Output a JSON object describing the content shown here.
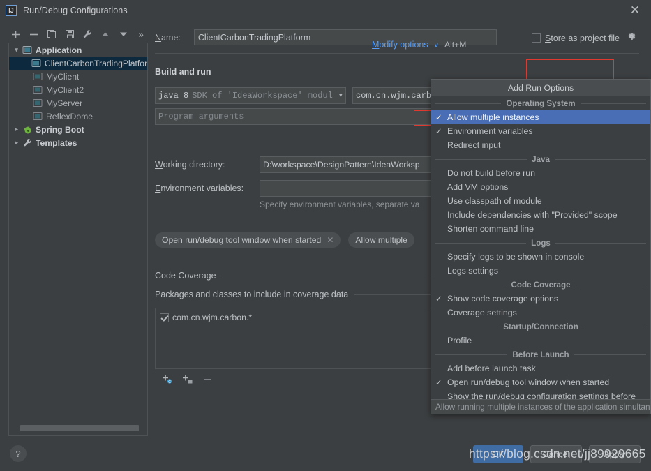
{
  "window": {
    "title": "Run/Debug Configurations",
    "logo_text": "IJ",
    "close_label": "✕"
  },
  "sidebar": {
    "toolbar": [
      {
        "name": "add-configuration-button",
        "glyph": "+"
      },
      {
        "name": "remove-configuration-button",
        "glyph": "−"
      },
      {
        "name": "copy-configuration-button",
        "glyph": "copy"
      },
      {
        "name": "save-configuration-button",
        "glyph": "save"
      },
      {
        "name": "edit-templates-button",
        "glyph": "wrench"
      },
      {
        "name": "move-up-button",
        "glyph": "up"
      },
      {
        "name": "move-down-button",
        "glyph": "down"
      },
      {
        "name": "more-options-button",
        "glyph": "»"
      }
    ],
    "tree": [
      {
        "label": "Application",
        "level": 0,
        "type": "group",
        "expanded": true,
        "icon": "application-icon",
        "selected": false
      },
      {
        "label": "ClientCarbonTradingPlatform",
        "level": 1,
        "type": "item",
        "icon": "application-icon",
        "selected": true
      },
      {
        "label": "MyClient",
        "level": 1,
        "type": "item",
        "icon": "application-icon",
        "selected": false
      },
      {
        "label": "MyClient2",
        "level": 1,
        "type": "item",
        "icon": "application-icon",
        "selected": false
      },
      {
        "label": "MyServer",
        "level": 1,
        "type": "item",
        "icon": "application-icon",
        "selected": false
      },
      {
        "label": "ReflexDome",
        "level": 1,
        "type": "item",
        "icon": "application-icon",
        "selected": false
      },
      {
        "label": "Spring Boot",
        "level": 0,
        "type": "group",
        "expanded": false,
        "icon": "spring-boot-icon",
        "selected": false
      },
      {
        "label": "Templates",
        "level": 0,
        "type": "group",
        "expanded": false,
        "icon": "wrench-icon",
        "selected": false
      }
    ],
    "help_label": "?"
  },
  "form": {
    "name_label": "Name:",
    "name_label_mnemonic": "N",
    "name_value": "ClientCarbonTradingPlatform",
    "store_as_project_file_label": "Store as project file",
    "store_as_project_file_mnemonic": "S",
    "store_as_project_file_checked": false,
    "build_and_run_title": "Build and run",
    "jre_value_bold": "java 8",
    "jre_value_rest": "SDK of 'IdeaWorkspace' modul",
    "main_class_value": "com.cn.wjm.carb",
    "program_arguments_placeholder": "Program arguments",
    "working_directory_label": "Working directory:",
    "working_directory_mnemonic": "W",
    "working_directory_value": "D:\\workspace\\DesignPattern\\IdeaWorksp",
    "environment_variables_label": "Environment variables:",
    "environment_variables_mnemonic": "E",
    "environment_variables_value": "",
    "environment_variables_hint": "Specify environment variables, separate va",
    "chips": [
      {
        "label": "Open run/debug tool window when started",
        "closable": true
      },
      {
        "label": "Allow multiple",
        "closable": false
      }
    ],
    "code_coverage_title": "Code Coverage",
    "packages_group_title": "Packages and classes to include in coverage data",
    "coverage_entries": [
      {
        "label": "com.cn.wjm.carbon.*",
        "checked": true
      }
    ],
    "coverage_toolbar": [
      {
        "name": "add-class-button",
        "glyph": "+c"
      },
      {
        "name": "add-package-button",
        "glyph": "+p"
      },
      {
        "name": "remove-entry-button",
        "glyph": "-"
      }
    ]
  },
  "modify_options": {
    "link_label": "Modify options",
    "link_mnemonic": "M",
    "caret": "∨",
    "shortcut": "Alt+M",
    "menu_header": "Add Run Options",
    "hint": "Allow running multiple instances of the application simultaneou",
    "groups": [
      {
        "title": "Operating System",
        "items": [
          {
            "label": "Allow multiple instances",
            "checked": true,
            "highlighted": true
          },
          {
            "label": "Environment variables",
            "checked": true,
            "highlighted": false
          },
          {
            "label": "Redirect input",
            "checked": false,
            "highlighted": false
          }
        ]
      },
      {
        "title": "Java",
        "items": [
          {
            "label": "Do not build before run",
            "checked": false,
            "highlighted": false
          },
          {
            "label": "Add VM options",
            "checked": false,
            "highlighted": false
          },
          {
            "label": "Use classpath of module",
            "checked": false,
            "highlighted": false
          },
          {
            "label": "Include dependencies with \"Provided\" scope",
            "checked": false,
            "highlighted": false
          },
          {
            "label": "Shorten command line",
            "checked": false,
            "highlighted": false
          }
        ]
      },
      {
        "title": "Logs",
        "items": [
          {
            "label": "Specify logs to be shown in console",
            "checked": false,
            "highlighted": false
          },
          {
            "label": "Logs settings",
            "checked": false,
            "highlighted": false
          }
        ]
      },
      {
        "title": "Code Coverage",
        "items": [
          {
            "label": "Show code coverage options",
            "checked": true,
            "highlighted": false
          },
          {
            "label": "Coverage settings",
            "checked": false,
            "highlighted": false
          }
        ]
      },
      {
        "title": "Startup/Connection",
        "items": [
          {
            "label": "Profile",
            "checked": false,
            "highlighted": false
          }
        ]
      },
      {
        "title": "Before Launch",
        "items": [
          {
            "label": "Add before launch task",
            "checked": false,
            "highlighted": false
          },
          {
            "label": "Open run/debug tool window when started",
            "checked": true,
            "highlighted": false
          },
          {
            "label": "Show the run/debug configuration settings before",
            "checked": false,
            "highlighted": false
          }
        ]
      }
    ]
  },
  "buttons": {
    "ok": "OK",
    "cancel": "Cancel",
    "apply": "Apply"
  },
  "watermark": "https://blog.csdn.net/jj89929665",
  "colors": {
    "dialog_bg": "#3c3f41",
    "accent_link": "#589df6",
    "menu_highlight": "#4a6eb5",
    "tree_selected": "#0d293e",
    "annotation_red": "#e03a30",
    "primary_button": "#3f6ca3"
  }
}
